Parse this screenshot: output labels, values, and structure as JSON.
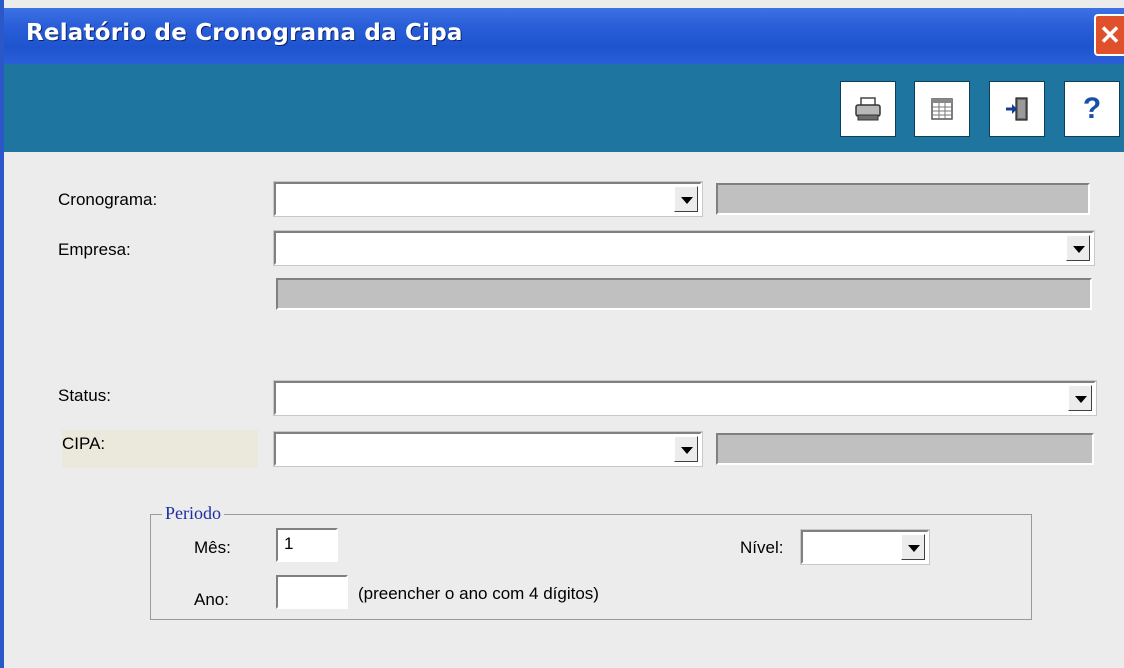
{
  "window": {
    "title": "Relatório de Cronograma da Cipa",
    "close_label": "✕"
  },
  "toolbar": {
    "buttons": [
      {
        "name": "print-button",
        "icon": "printer-icon"
      },
      {
        "name": "preview-button",
        "icon": "table-icon"
      },
      {
        "name": "exit-button",
        "icon": "door-exit-icon"
      },
      {
        "name": "help-button",
        "icon": "help-icon",
        "glyph": "?"
      }
    ]
  },
  "form": {
    "cronograma_label": "Cronograma:",
    "empresa_label": "Empresa:",
    "status_label": "Status:",
    "cipa_label": "CIPA:"
  },
  "periodo": {
    "legend": "Periodo",
    "mes_label": "Mês:",
    "mes_value": "1",
    "ano_label": "Ano:",
    "ano_value": "",
    "ano_hint": "(preencher o ano com 4 dígitos)",
    "nivel_label": "Nível:"
  },
  "colors": {
    "toolbar_bg": "#1e75a0",
    "titlebar": "#2a5fd8",
    "legend_text": "#1d2fa0"
  }
}
